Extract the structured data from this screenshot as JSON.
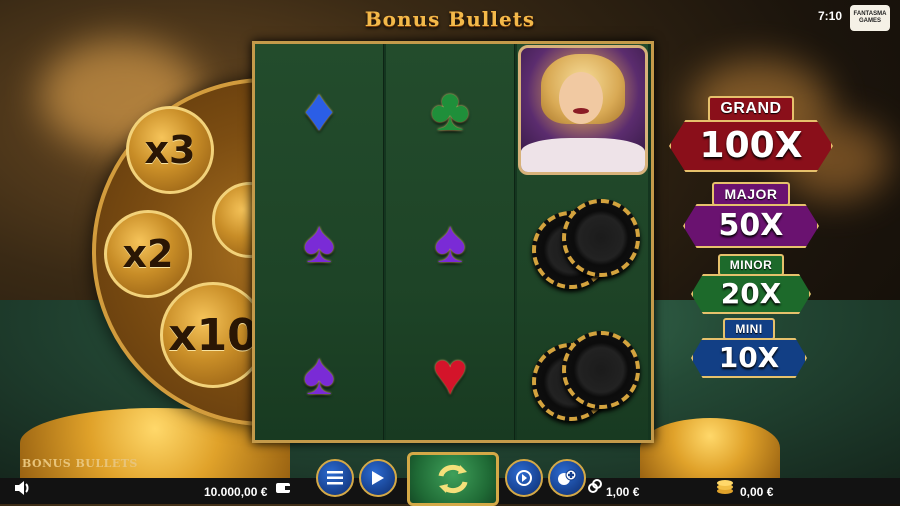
{
  "header": {
    "title": "Bonus Bullets",
    "clock": "7:10",
    "brand": "FANTASMA GAMES"
  },
  "cylinder": {
    "multipliers": [
      "x3",
      "x2",
      "x10"
    ]
  },
  "reels": [
    [
      "blue-diamond",
      "purple-spade",
      "purple-spade"
    ],
    [
      "green-club",
      "purple-spade",
      "red-heart"
    ],
    [
      "blonde-lady-portrait",
      "black-poker-chips",
      "black-poker-chips"
    ]
  ],
  "symbol_glyphs": {
    "blue-diamond": "♦",
    "purple-spade": "♠",
    "green-club": "♣",
    "red-heart": "♥"
  },
  "symbol_colors": {
    "blue-diamond": "#2b5ee6",
    "purple-spade": "#7a2bd6",
    "green-club": "#1f8f3a",
    "red-heart": "#d4142a"
  },
  "jackpots": [
    {
      "label": "GRAND",
      "value": "100X",
      "color": "#8a0f1a"
    },
    {
      "label": "MAJOR",
      "value": "50X",
      "color": "#6a1270"
    },
    {
      "label": "MINOR",
      "value": "20X",
      "color": "#1d6a2b"
    },
    {
      "label": "MINI",
      "value": "10X",
      "color": "#123f85"
    }
  ],
  "footer": {
    "game_logo": "BONUS BULLETS",
    "balance": "10.000,00 €",
    "bet": "1,00 €",
    "win": "0,00 €"
  }
}
